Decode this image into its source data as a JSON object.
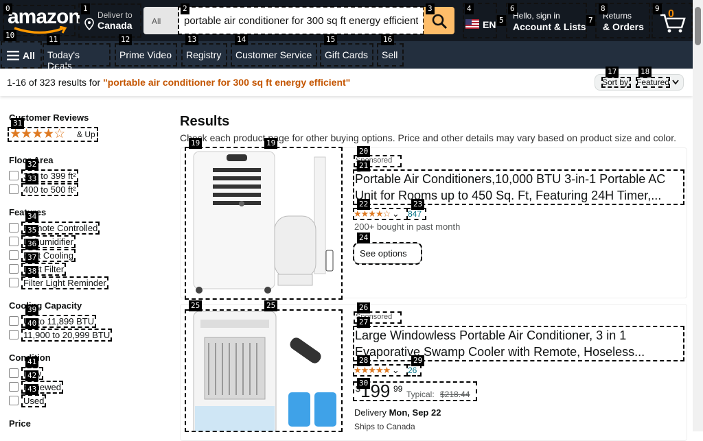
{
  "header": {
    "logo_text": "amazon",
    "deliver_small": "Deliver to",
    "deliver_big": "Canada",
    "search_category": "All",
    "search_value": "portable air conditioner for 300 sq ft energy efficient",
    "lang": "EN",
    "account_small": "Hello, sign in",
    "account_big": "Account & Lists",
    "returns_small": "Returns",
    "returns_big": "& Orders",
    "cart_count": "0"
  },
  "nav": {
    "all": "All",
    "items": [
      "Today's Deals",
      "Prime Video",
      "Registry",
      "Customer Service",
      "Gift Cards",
      "Sell"
    ]
  },
  "results_bar": {
    "summary": "1-16 of 323 results for ",
    "query": "\"portable air conditioner for 300 sq ft energy efficient\"",
    "sort_label": "Sort by:",
    "sort_value": "Featured"
  },
  "sidebar": {
    "reviews_heading": "Customer Reviews",
    "reviews_stars": "★★★★☆",
    "reviews_up": "& Up",
    "floor_heading": "Floor Area",
    "floor": [
      "300 to 399 ft²",
      "400 to 500 ft²"
    ],
    "features_heading": "Features",
    "features": [
      "Remote Controlled",
      "Dehumidifier",
      "Fast Cooling",
      "Dust Filter",
      "Filter Light Reminder"
    ],
    "capacity_heading": "Cooling Capacity",
    "capacity": [
      "Up to 11,899 BTU",
      "11,900 to 20,999 BTU"
    ],
    "condition_heading": "Condition",
    "condition": [
      "New",
      "Renewed",
      "Used"
    ],
    "price_heading": "Price"
  },
  "main": {
    "title": "Results",
    "subtitle": "Check each product page for other buying options. Price and other details may vary based on product size and color.",
    "products": [
      {
        "sponsored": "Sponsored",
        "title": "Portable Air Conditioners,10,000 BTU 3-in-1 Portable AC Unit for Rooms up to 450 Sq. Ft, Featuring 24H Timer,...",
        "stars": "★★★★☆",
        "rating_count": "847",
        "bought": "200+ bought in past month",
        "button": "See options"
      },
      {
        "sponsored": "Sponsored",
        "title": "Large Windowless Portable Air Conditioner, 3 in 1 Evaporative Swamp Cooler with Remote, Hoseless...",
        "stars": "★★★★★",
        "rating_count": "26",
        "price_symbol": "$",
        "price_whole": "199",
        "price_cents": "99",
        "typical_label": "Typical:",
        "typical_price": "$218.44",
        "delivery_label": "Delivery",
        "delivery_date": "Mon, Sep 22",
        "ships": "Ships to Canada"
      }
    ]
  },
  "tags": [
    "0",
    "1",
    "2",
    "3",
    "4",
    "5",
    "6",
    "7",
    "8",
    "9",
    "10",
    "11",
    "12",
    "13",
    "14",
    "15",
    "16",
    "17",
    "18",
    "19",
    "20",
    "21",
    "22",
    "23",
    "24",
    "25",
    "26",
    "27",
    "28",
    "29",
    "30",
    "31",
    "32",
    "33",
    "34",
    "35",
    "36",
    "37",
    "38",
    "39",
    "40",
    "41",
    "42",
    "43"
  ],
  "colors": {
    "header_bg": "#131921",
    "nav_bg": "#232f3e",
    "search_button": "#febd69",
    "accent_orange": "#f08804",
    "query_color": "#c45500",
    "link_teal": "#007185",
    "star_color": "#de7921"
  }
}
